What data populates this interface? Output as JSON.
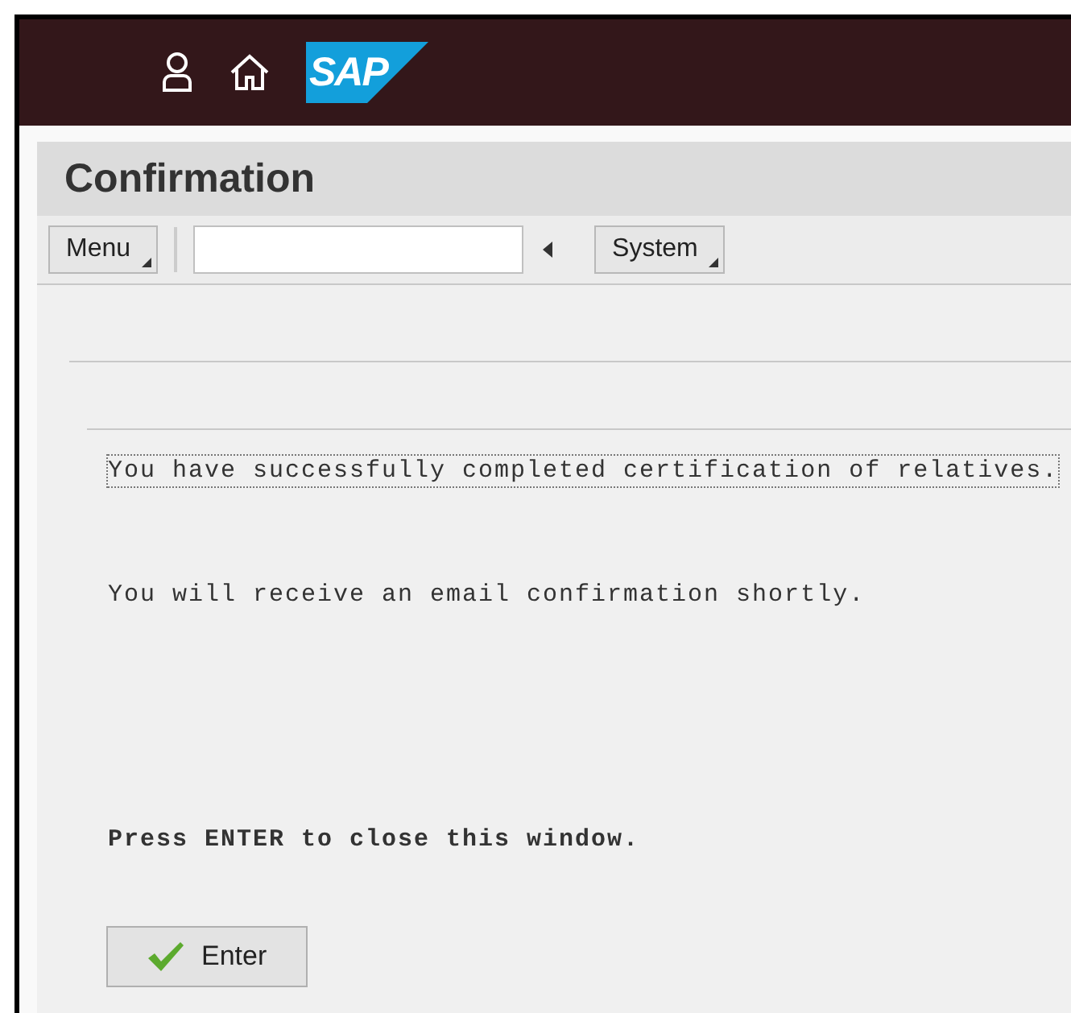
{
  "shell": {
    "logo": "SAP"
  },
  "title": "Confirmation",
  "toolbar": {
    "menu_button": "Menu",
    "system_button": "System"
  },
  "messages": [
    {
      "text": "You have successfully completed certification of relatives.",
      "focused": true,
      "bold": false
    },
    {
      "text": "You will receive an email confirmation shortly.",
      "focused": false,
      "bold": false
    },
    {
      "text": "Press ENTER to close this window.",
      "focused": false,
      "bold": true
    }
  ],
  "enter_button": "Enter"
}
